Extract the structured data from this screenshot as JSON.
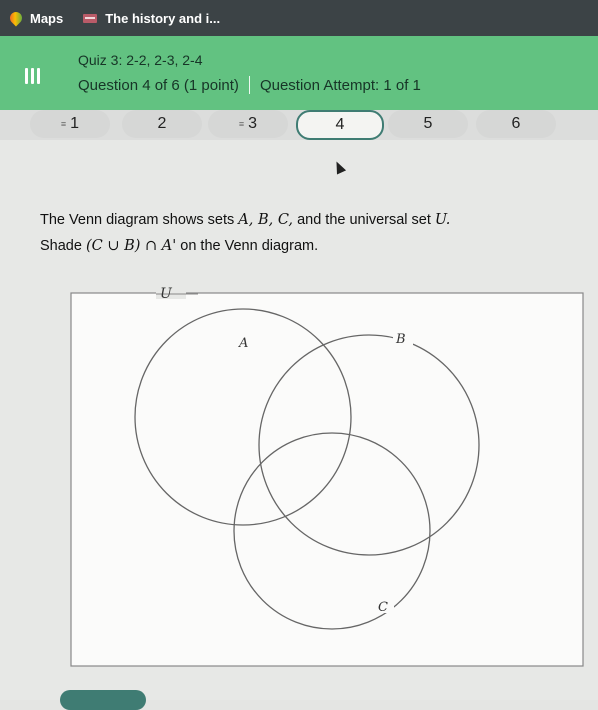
{
  "bookmarks": [
    {
      "label": "Maps",
      "icon": "maps-icon"
    },
    {
      "label": "The history and i...",
      "icon": "site-favicon-icon"
    }
  ],
  "header": {
    "quiz_title": "Quiz 3: 2-2, 2-3, 2-4",
    "question_info": "Question 4 of 6 (1 point)",
    "attempt_info": "Question Attempt: 1 of 1",
    "color": "#62c281"
  },
  "question_nav": [
    {
      "label": "1",
      "flagged": true
    },
    {
      "label": "2",
      "flagged": false
    },
    {
      "label": "3",
      "flagged": true
    },
    {
      "label": "4",
      "flagged": false,
      "current": true
    },
    {
      "label": "5",
      "flagged": false
    },
    {
      "label": "6",
      "flagged": false
    }
  ],
  "prompt": {
    "line1_prefix": "The Venn diagram shows sets ",
    "line1_sets": "A, B, C,",
    "line1_middle": " and the universal set ",
    "line1_universal": "U.",
    "line2_prefix": "Shade ",
    "line2_expr": "(C ∪ B) ∩ A'",
    "line2_suffix": " on the Venn diagram."
  },
  "venn": {
    "universal_label": "U",
    "set_labels": {
      "A": "A",
      "B": "B",
      "C": "C"
    }
  }
}
